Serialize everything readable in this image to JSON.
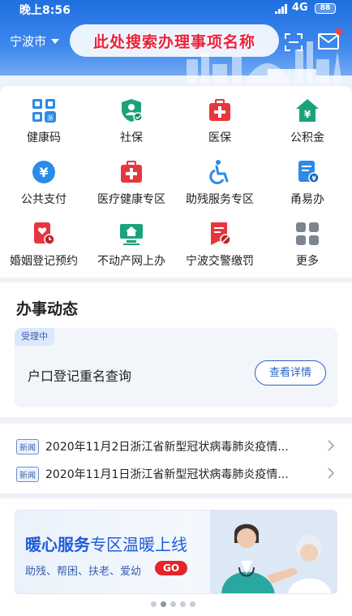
{
  "status_bar": {
    "time": "晚上8:56",
    "network": "4G",
    "battery": "88"
  },
  "header": {
    "city": "宁波市",
    "search_placeholder": "此处搜索办理事项名称"
  },
  "services": [
    {
      "label": "健康码",
      "icon": "health-code-icon"
    },
    {
      "label": "社保",
      "icon": "social-security-icon"
    },
    {
      "label": "医保",
      "icon": "medical-insurance-icon"
    },
    {
      "label": "公积金",
      "icon": "housing-fund-icon"
    },
    {
      "label": "公共支付",
      "icon": "public-payment-icon"
    },
    {
      "label": "医疗健康专区",
      "icon": "medical-health-icon"
    },
    {
      "label": "助残服务专区",
      "icon": "disability-service-icon"
    },
    {
      "label": "甬易办",
      "icon": "yongyiban-icon"
    },
    {
      "label": "婚姻登记预约",
      "icon": "marriage-registration-icon"
    },
    {
      "label": "不动产网上办",
      "icon": "real-estate-icon"
    },
    {
      "label": "宁波交警缴罚",
      "icon": "traffic-fine-icon"
    },
    {
      "label": "更多",
      "icon": "more-grid-icon"
    }
  ],
  "affairs": {
    "title": "办事动态",
    "status_badge": "受理中",
    "item": "户口登记重名查询",
    "detail_button": "查看详情"
  },
  "news": [
    {
      "tag": "新闻",
      "text": "2020年11月2日浙江省新型冠状病毒肺炎疫情..."
    },
    {
      "tag": "新闻",
      "text": "2020年11月1日浙江省新型冠状病毒肺炎疫情..."
    }
  ],
  "banner": {
    "title_highlight": "暖心服务",
    "title_rest": "专区温暖上线",
    "subtitle": "助残、帮困、扶老、爱幼",
    "go_label": "GO",
    "total_slides": 5,
    "active_slide": 2
  },
  "colors": {
    "brand_blue": "#1f6fe0",
    "accent_red": "#e8223c",
    "teal": "#1aa37a"
  }
}
